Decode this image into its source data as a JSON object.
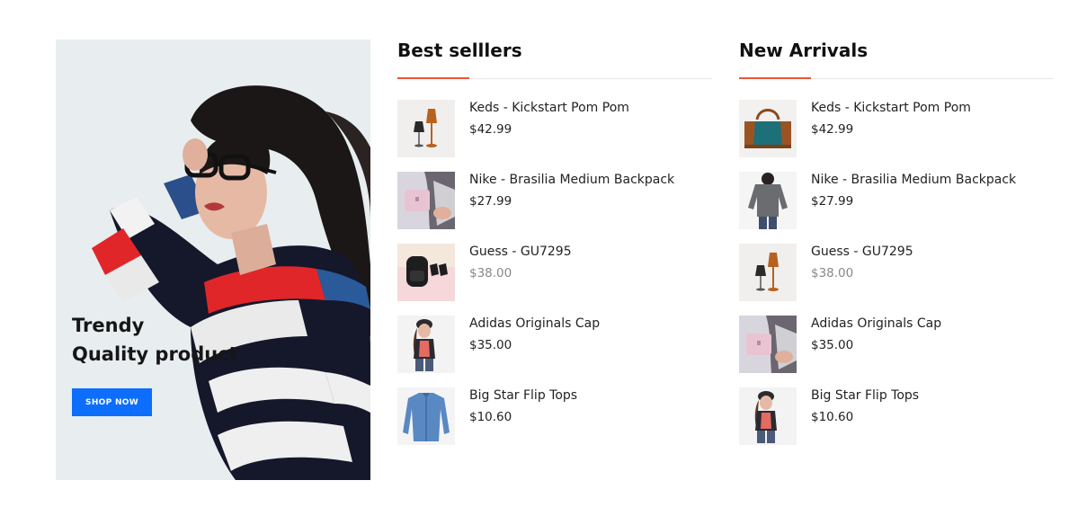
{
  "banner": {
    "line1": "Trendy",
    "line2": "Quality product",
    "button_label": "SHOP NOW",
    "button_color": "#0d6efd"
  },
  "accent_color": "#e8543b",
  "best_sellers": {
    "title": "Best selllers",
    "items": [
      {
        "name": "Keds - Kickstart Pom Pom",
        "price": "$42.99",
        "thumb": "lamps-icon"
      },
      {
        "name": "Nike - Brasilia Medium Backpack",
        "price": "$27.99",
        "thumb": "pink-bag-icon"
      },
      {
        "name": "Guess - GU7295",
        "price": "$38.00",
        "thumb": "backpack-icon"
      },
      {
        "name": "Adidas Originals Cap",
        "price": "$35.00",
        "thumb": "model-cap-icon"
      },
      {
        "name": "Big Star Flip Tops",
        "price": "$10.60",
        "thumb": "denim-shirt-icon"
      }
    ]
  },
  "new_arrivals": {
    "title": "New Arrivals",
    "items": [
      {
        "name": "Keds - Kickstart Pom Pom",
        "price": "$42.99",
        "thumb": "handbag-icon"
      },
      {
        "name": "Nike - Brasilia Medium Backpack",
        "price": "$27.99",
        "thumb": "model-sweater-icon"
      },
      {
        "name": "Guess - GU7295",
        "price": "$38.00",
        "thumb": "lamps-icon"
      },
      {
        "name": "Adidas Originals Cap",
        "price": "$35.00",
        "thumb": "pink-bag-icon"
      },
      {
        "name": "Big Star Flip Tops",
        "price": "$10.60",
        "thumb": "model-cap-icon"
      }
    ]
  }
}
